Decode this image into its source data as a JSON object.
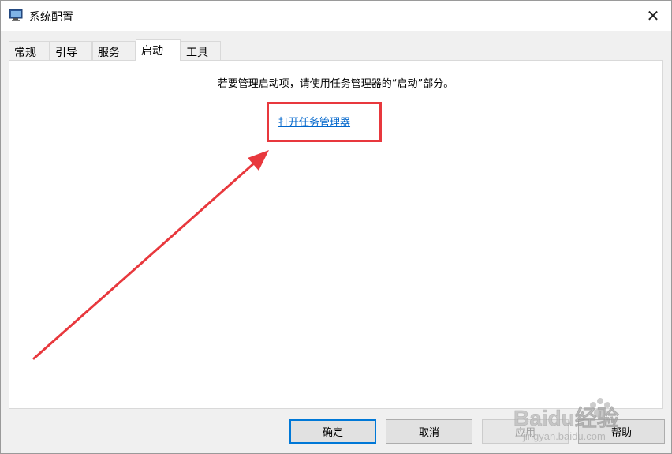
{
  "window": {
    "title": "系统配置",
    "close_glyph": "✕"
  },
  "tabs": [
    {
      "label": "常规",
      "active": false
    },
    {
      "label": "引导",
      "active": false
    },
    {
      "label": "服务",
      "active": false
    },
    {
      "label": "启动",
      "active": true
    },
    {
      "label": "工具",
      "active": false
    }
  ],
  "startup_panel": {
    "info_text": "若要管理启动项，请使用任务管理器的“启动”部分。",
    "link_text": "打开任务管理器"
  },
  "buttons": {
    "ok": "确定",
    "cancel": "取消",
    "apply": "应用",
    "help": "帮助"
  },
  "annotation": {
    "highlight_color": "#e8383d"
  },
  "watermark": {
    "brand": "Baidu经验",
    "url": "jingyan.baidu.com"
  },
  "colors": {
    "link": "#0066cc",
    "default_button_border": "#0078d7",
    "window_bg": "#f0f0f0"
  }
}
